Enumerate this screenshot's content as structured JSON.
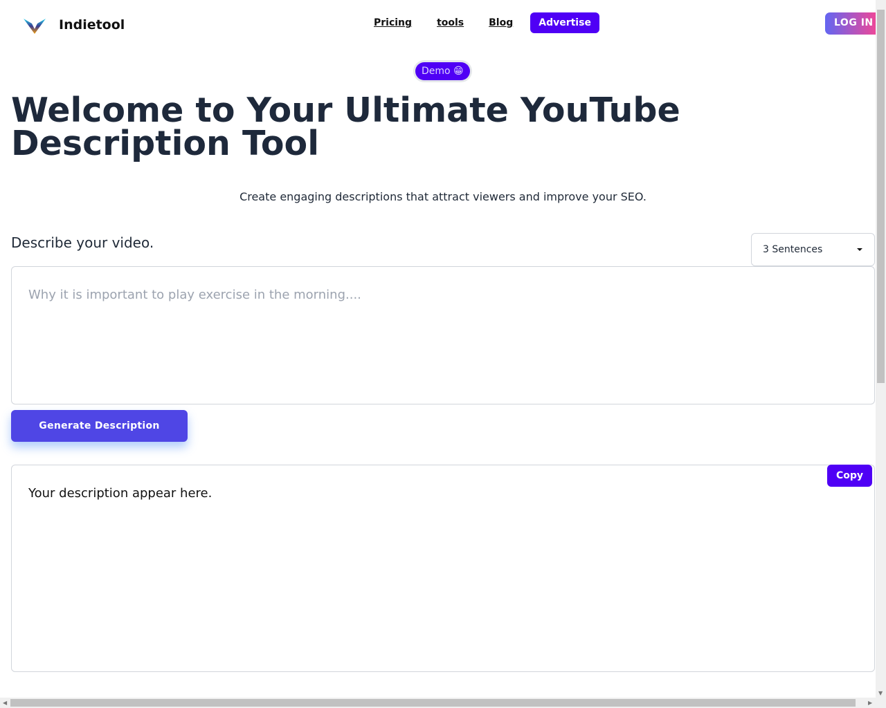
{
  "header": {
    "brand": "Indietool",
    "nav": [
      "Pricing",
      "tools",
      "Blog"
    ],
    "advertise": "Advertise",
    "login": "LOG IN"
  },
  "badge": "Demo 😁",
  "hero": {
    "title": "Welcome to Your Ultimate YouTube Description Tool",
    "subtitle": "Create engaging descriptions that attract viewers and improve your SEO."
  },
  "form": {
    "label": "Describe your video.",
    "length_select": "3 Sentences",
    "input_placeholder": "Why it is important to play exercise in the morning....",
    "generate": "Generate Description"
  },
  "output": {
    "placeholder": "Your description appear here.",
    "copy": "Copy"
  },
  "colors": {
    "primary": "#4f00f5",
    "button": "#4f46e5"
  }
}
